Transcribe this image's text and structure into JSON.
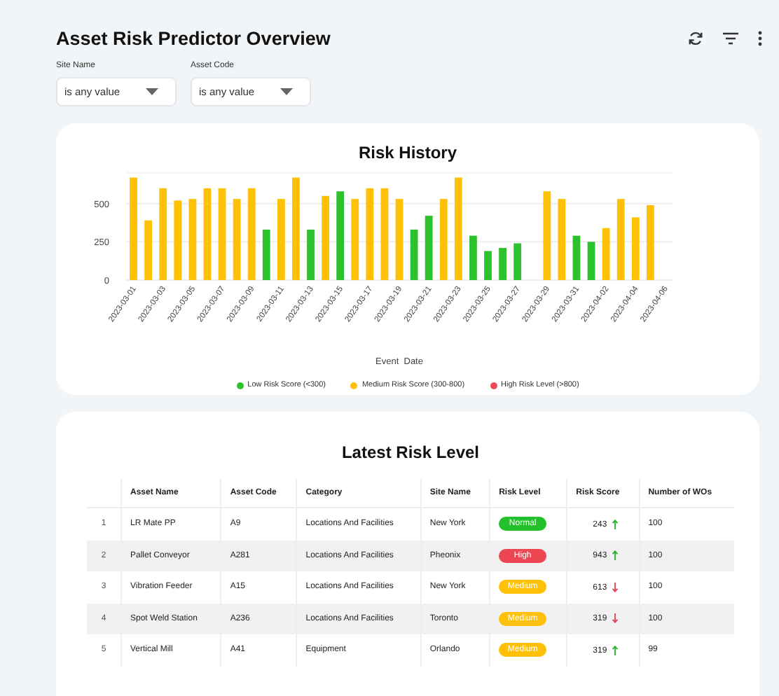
{
  "header": {
    "title": "Asset Risk Predictor Overview",
    "actions": [
      {
        "kind": "refresh"
      },
      {
        "kind": "filter"
      },
      {
        "kind": "more"
      }
    ]
  },
  "filters": [
    {
      "label": "Site Name",
      "value": "is any value"
    },
    {
      "label": "Asset Code",
      "value": "is any value"
    }
  ],
  "risk_history": {
    "title": "Risk History",
    "chart_data": {
      "type": "bar",
      "stacked": true,
      "xlabel": "Event  Date",
      "ylim": [
        0,
        700
      ],
      "yticks": [
        0,
        250,
        500
      ],
      "categories": [
        "2023-03-01",
        null,
        "2023-03-03",
        null,
        "2023-03-05",
        null,
        "2023-03-07",
        null,
        "2023-03-09",
        null,
        "2023-03-11",
        null,
        "2023-03-13",
        null,
        "2023-03-15",
        null,
        "2023-03-17",
        null,
        "2023-03-19",
        null,
        "2023-03-21",
        null,
        "2023-03-23",
        null,
        "2023-03-25",
        null,
        "2023-03-27",
        null,
        "2023-03-29",
        null,
        "2023-03-31",
        null,
        "2023-04-02",
        null,
        "2023-04-04",
        null,
        "2023-04-06"
      ],
      "series": [
        {
          "name": "Low Risk Score (<300)",
          "color": "#2dc12d",
          "values": [
            null,
            null,
            null,
            null,
            null,
            null,
            null,
            null,
            null,
            330,
            null,
            null,
            330,
            null,
            580,
            null,
            null,
            null,
            null,
            330,
            420,
            null,
            null,
            290,
            190,
            210,
            240,
            null,
            null,
            null,
            290,
            250,
            null,
            null,
            null,
            null,
            null
          ]
        },
        {
          "name": "Medium Risk Score (300-800)",
          "color": "#ffc107",
          "values": [
            670,
            390,
            600,
            520,
            530,
            600,
            600,
            530,
            600,
            null,
            530,
            670,
            null,
            550,
            null,
            530,
            600,
            600,
            530,
            null,
            null,
            530,
            670,
            null,
            null,
            null,
            null,
            null,
            580,
            530,
            null,
            null,
            340,
            530,
            410,
            490,
            null
          ]
        },
        {
          "name": "High Risk Level (>800)",
          "color": "#ee4b55",
          "values": [
            null,
            null,
            null,
            null,
            null,
            null,
            null,
            null,
            null,
            null,
            null,
            null,
            null,
            null,
            null,
            null,
            null,
            null,
            null,
            null,
            null,
            null,
            null,
            null,
            null,
            null,
            null,
            null,
            null,
            null,
            null,
            null,
            null,
            null,
            null,
            null,
            null
          ]
        }
      ]
    }
  },
  "latest_risk": {
    "title": "Latest Risk Level",
    "columns": [
      "Asset Name",
      "Asset Code",
      "Category",
      "Site Name",
      "Risk Level",
      "Risk Score",
      "Number of WOs"
    ],
    "rows": [
      {
        "index": "1",
        "asset_name": "LR Mate PP",
        "asset_code": "A9",
        "category": "Locations And Facilities",
        "site": "New York",
        "risk": "Normal",
        "color": "#22c02a",
        "score": "243",
        "trend_up": true,
        "wos": "100"
      },
      {
        "index": "2",
        "asset_name": "Pallet Conveyor",
        "asset_code": "A281",
        "category": "Locations And Facilities",
        "site": "Pheonix",
        "risk": "High",
        "color": "#ec4652",
        "score": "943",
        "trend_up": true,
        "wos": "100"
      },
      {
        "index": "3",
        "asset_name": "Vibration Feeder",
        "asset_code": "A15",
        "category": "Locations And Facilities",
        "site": "New York",
        "risk": "Medium",
        "color": "#ffc107",
        "score": "613",
        "trend_up": false,
        "wos": "100"
      },
      {
        "index": "4",
        "asset_name": "Spot Weld Station",
        "asset_code": "A236",
        "category": "Locations And Facilities",
        "site": "Toronto",
        "risk": "Medium",
        "color": "#ffc107",
        "score": "319",
        "trend_up": false,
        "wos": "100"
      },
      {
        "index": "5",
        "asset_name": "Vertical Mill",
        "asset_code": "A41",
        "category": "Equipment",
        "site": "Orlando",
        "risk": "Medium",
        "color": "#ffc107",
        "score": "319",
        "trend_up": true,
        "wos": "99"
      }
    ]
  }
}
